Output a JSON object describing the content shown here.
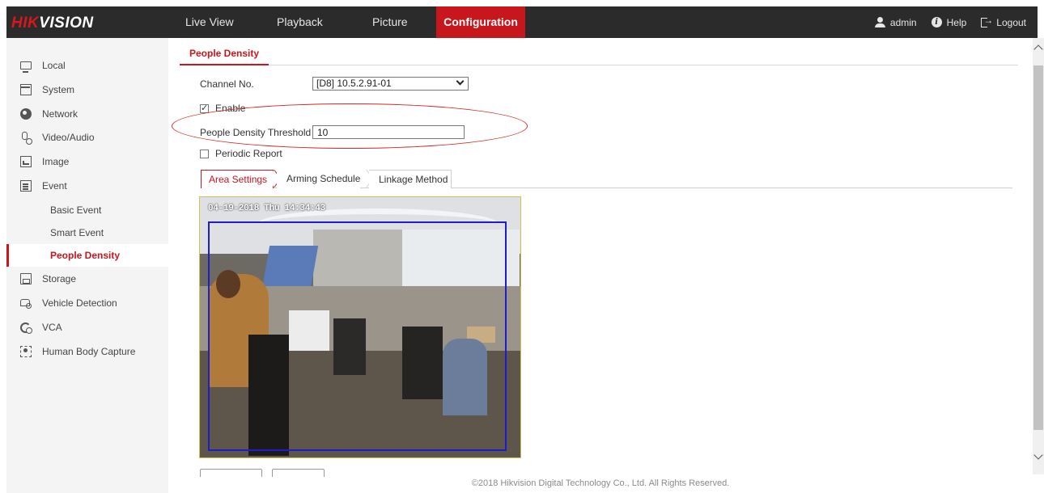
{
  "header": {
    "logo_hik": "HIK",
    "logo_vision": "VISION",
    "nav": [
      "Live View",
      "Playback",
      "Picture",
      "Configuration"
    ],
    "active_nav": "Configuration",
    "user": "admin",
    "help": "Help",
    "logout": "Logout"
  },
  "sidebar": {
    "items": [
      {
        "label": "Local",
        "icon": "monitor-icon"
      },
      {
        "label": "System",
        "icon": "system-icon"
      },
      {
        "label": "Network",
        "icon": "globe-icon"
      },
      {
        "label": "Video/Audio",
        "icon": "microphone-camera-icon"
      },
      {
        "label": "Image",
        "icon": "image-icon"
      },
      {
        "label": "Event",
        "icon": "event-list-icon"
      },
      {
        "label": "Basic Event",
        "sub": true
      },
      {
        "label": "Smart Event",
        "sub": true
      },
      {
        "label": "People Density",
        "sub": true,
        "active": true
      },
      {
        "label": "Storage",
        "icon": "storage-icon"
      },
      {
        "label": "Vehicle Detection",
        "icon": "vehicle-icon"
      },
      {
        "label": "VCA",
        "icon": "vca-icon"
      },
      {
        "label": "Human Body Capture",
        "icon": "human-body-icon"
      }
    ]
  },
  "page": {
    "tab": "People Density",
    "channel_label": "Channel No.",
    "channel_value": "[D8] 10.5.2.91-01",
    "enable_label": "Enable",
    "enable_checked": true,
    "threshold_label": "People Density Threshold",
    "threshold_value": "10",
    "periodic_label": "Periodic Report",
    "periodic_checked": false,
    "subtabs": [
      "Area Settings",
      "Arming Schedule",
      "Linkage Method"
    ],
    "active_subtab": "Area Settings",
    "video_osd": "04-19-2018 Thu 14:34:43"
  },
  "footer": "©2018 Hikvision Digital Technology Co., Ltd. All Rights Reserved.",
  "colors": {
    "accent": "#c8161d",
    "topbar": "#2b2b2b",
    "sidebar": "#f4f4f4",
    "roi": "#1e1ec8",
    "annotation": "#d62626"
  }
}
